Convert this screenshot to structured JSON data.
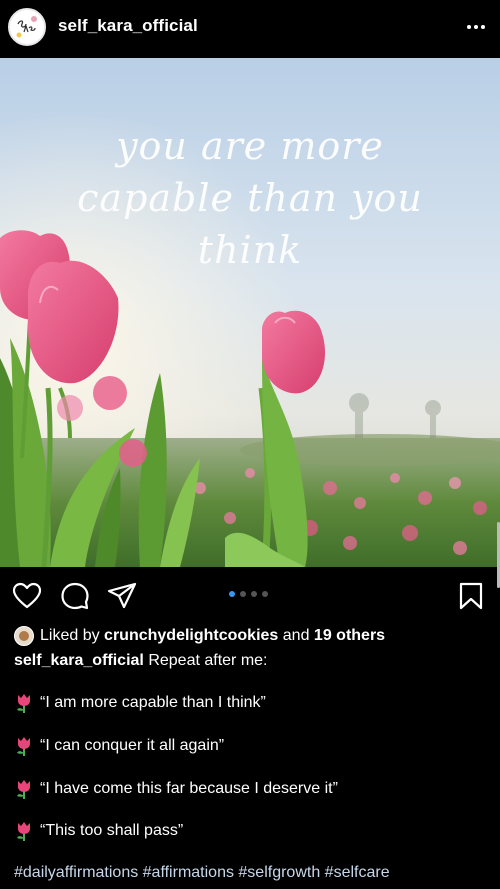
{
  "header": {
    "username": "self_kara_official",
    "avatar_text": "Self Kara",
    "more_icon": "more-horizontal-icon"
  },
  "post": {
    "overlay_text": [
      "you are more",
      "capable than you",
      "think"
    ],
    "carousel": {
      "count": 4,
      "active_index": 0
    }
  },
  "actions": {
    "like_icon": "heart-icon",
    "comment_icon": "comment-icon",
    "share_icon": "send-icon",
    "save_icon": "bookmark-icon"
  },
  "likes": {
    "prefix": "Liked by",
    "user": "crunchydelightcookies",
    "middle": "and",
    "others": "19 others"
  },
  "caption": {
    "author": "self_kara_official",
    "text": "Repeat after me:",
    "lines": [
      "“I am more capable than I think”",
      "“I can conquer it all again”",
      "“I have come this far because I deserve it”",
      "“This too shall pass”"
    ],
    "line_icon": "tulip-icon",
    "hashtags": "#dailyaffirmations #affirmations #selfgrowth #selfcare"
  },
  "colors": {
    "background": "#000000",
    "carousel_active": "#3897f0",
    "hashtag": "#c7d7ea"
  }
}
